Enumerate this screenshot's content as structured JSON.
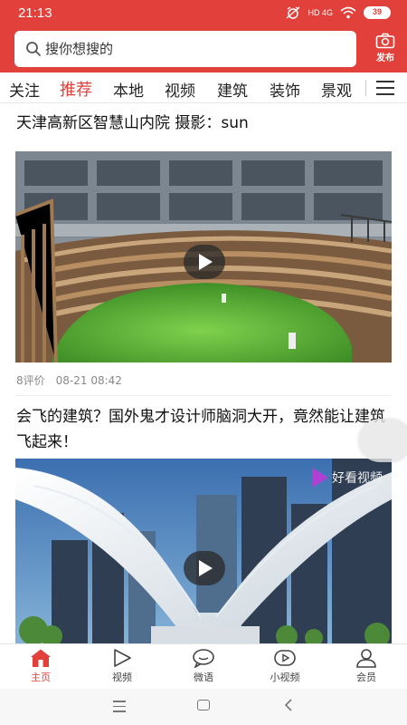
{
  "status_bar": {
    "time": "21:13",
    "network": "HD 4G",
    "battery": "39"
  },
  "header": {
    "search": {
      "placeholder": "搜你想搜的",
      "icon": "search-icon"
    },
    "publish": {
      "label": "发布",
      "icon": "camera-icon"
    },
    "color": "#e2403a"
  },
  "tabs": [
    {
      "label": "关注",
      "active": false
    },
    {
      "label": "推荐",
      "active": true
    },
    {
      "label": "本地",
      "active": false
    },
    {
      "label": "视频",
      "active": false
    },
    {
      "label": "建筑",
      "active": false
    },
    {
      "label": "装饰",
      "active": false
    },
    {
      "label": "景观",
      "active": false
    }
  ],
  "feed": {
    "items": [
      {
        "title": "天津高新区智慧山内院 摄影：sun",
        "comments": "8评价",
        "time": "08-21 08:42",
        "thumbnail": "video-thumbnail-courtyard"
      },
      {
        "title": "会飞的建筑？国外鬼才设计师脑洞大开，竟然能让建筑飞起来！",
        "thumbnail": "video-thumbnail-winged-building",
        "watermark": "好看视频"
      }
    ]
  },
  "bottom_nav": [
    {
      "label": "主页",
      "icon": "home-icon",
      "active": true
    },
    {
      "label": "视频",
      "icon": "play-icon",
      "active": false
    },
    {
      "label": "微语",
      "icon": "chat-icon",
      "active": false
    },
    {
      "label": "小视频",
      "icon": "mini-video-icon",
      "active": false
    },
    {
      "label": "会员",
      "icon": "user-icon",
      "active": false
    }
  ]
}
